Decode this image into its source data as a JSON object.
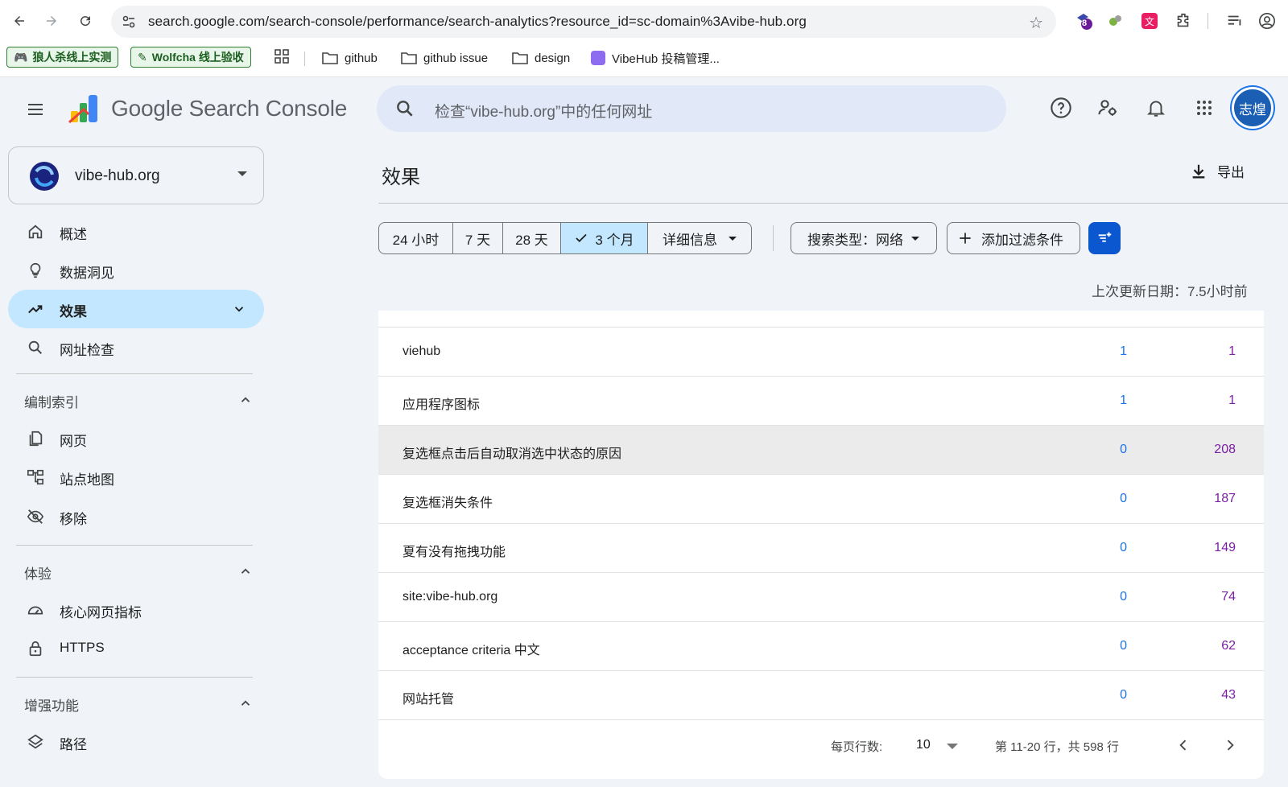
{
  "browser": {
    "url": "search.google.com/search-console/performance/search-analytics?resource_id=sc-domain%3Avibe-hub.org",
    "extension_badge": "8",
    "bookmarks": [
      {
        "label": "狼人杀线上实测",
        "icon": "gamepad-icon"
      },
      {
        "label": "Wolfcha 线上验收",
        "icon": "pencil-icon"
      },
      {
        "label": "github",
        "icon": "folder-icon"
      },
      {
        "label": "github issue",
        "icon": "folder-icon"
      },
      {
        "label": "design",
        "icon": "folder-icon"
      },
      {
        "label": "VibeHub 投稿管理...",
        "icon": "vibehub-icon"
      }
    ]
  },
  "header": {
    "app_title_google": "Google",
    "app_title_rest": " Search Console",
    "search_placeholder": "检查“vibe-hub.org”中的任何网址",
    "avatar_text": "志煌"
  },
  "sidebar": {
    "property": "vibe-hub.org",
    "items": [
      {
        "label": "概述",
        "icon": "home-icon"
      },
      {
        "label": "数据洞见",
        "icon": "lightbulb-icon"
      },
      {
        "label": "效果",
        "icon": "trending-up-icon",
        "active": true
      },
      {
        "label": "网址检查",
        "icon": "search-icon"
      }
    ],
    "sections": [
      {
        "title": "编制索引",
        "items": [
          {
            "label": "网页",
            "icon": "pages-icon"
          },
          {
            "label": "站点地图",
            "icon": "sitemap-icon"
          },
          {
            "label": "移除",
            "icon": "eye-off-icon"
          }
        ]
      },
      {
        "title": "体验",
        "items": [
          {
            "label": "核心网页指标",
            "icon": "speed-icon"
          },
          {
            "label": "HTTPS",
            "icon": "lock-icon"
          }
        ]
      },
      {
        "title": "增强功能",
        "items": [
          {
            "label": "路径",
            "icon": "layers-icon"
          }
        ]
      }
    ]
  },
  "main": {
    "title": "效果",
    "export_label": "导出",
    "date_ranges": [
      "24 小时",
      "7 天",
      "28 天",
      "3 个月",
      "详细信息"
    ],
    "selected_range": "3 个月",
    "search_type": "搜索类型：网络",
    "add_filter": "添加过滤条件",
    "last_updated": "上次更新日期：7.5小时前",
    "rows": [
      {
        "query": "viehub",
        "clicks": "1",
        "impressions": "1"
      },
      {
        "query": "应用程序图标",
        "clicks": "1",
        "impressions": "1"
      },
      {
        "query": "复选框点击后自动取消选中状态的原因",
        "clicks": "0",
        "impressions": "208"
      },
      {
        "query": "复选框消失条件",
        "clicks": "0",
        "impressions": "187"
      },
      {
        "query": "夏有没有拖拽功能",
        "clicks": "0",
        "impressions": "149"
      },
      {
        "query": "site:vibe-hub.org",
        "clicks": "0",
        "impressions": "74"
      },
      {
        "query": "acceptance criteria 中文",
        "clicks": "0",
        "impressions": "62"
      },
      {
        "query": "网站托管",
        "clicks": "0",
        "impressions": "43"
      }
    ],
    "pagination": {
      "rows_per_page_label": "每页行数:",
      "rows_per_page": "10",
      "range_text": "第 11-20 行，共 598 行"
    }
  },
  "colors": {
    "accent": "#0b57d0",
    "active_nav": "#c2e7ff",
    "clicks": "#1a73e8",
    "impressions": "#7b1fa2",
    "app_bg": "#f0f4f9"
  }
}
